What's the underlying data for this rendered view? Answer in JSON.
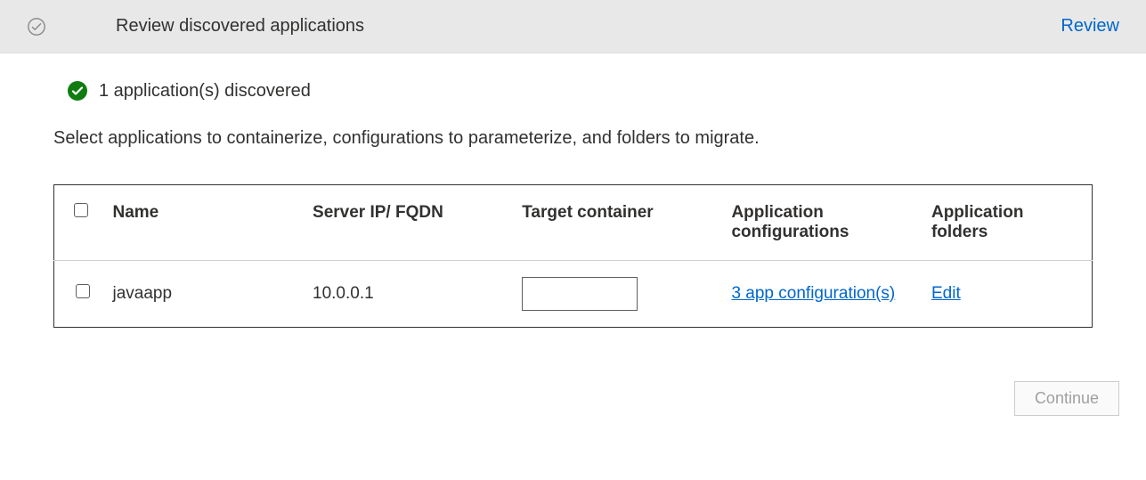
{
  "header": {
    "title": "Review discovered applications",
    "action": "Review"
  },
  "status": {
    "message": "1 application(s) discovered"
  },
  "instruction": "Select applications to containerize, configurations to parameterize, and folders to migrate.",
  "table": {
    "headers": {
      "name": "Name",
      "server": "Server IP/ FQDN",
      "target": "Target container",
      "config": "Application configurations",
      "folders": "Application folders"
    },
    "rows": [
      {
        "name": "javaapp",
        "server": "10.0.0.1",
        "target": "",
        "config_link": "3 app configuration(s)",
        "folders_link": "Edit"
      }
    ]
  },
  "footer": {
    "continue_label": "Continue"
  }
}
